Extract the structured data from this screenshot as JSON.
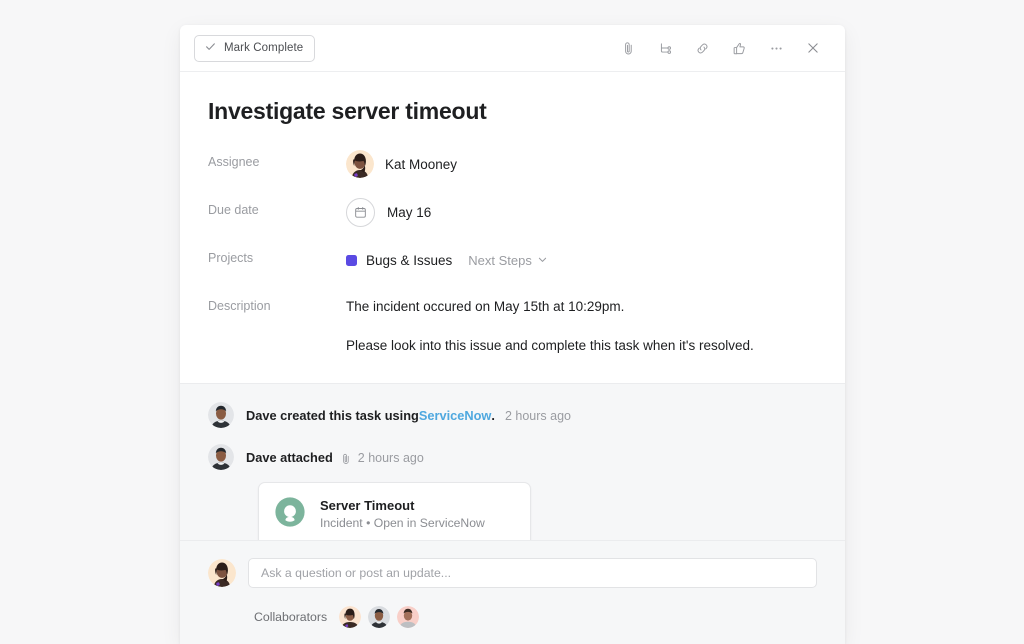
{
  "topbar": {
    "mark_complete_label": "Mark Complete",
    "check_icon": "check-icon",
    "actions": [
      {
        "name": "attachment-icon",
        "label": "Attach file"
      },
      {
        "name": "subtask-icon",
        "label": "Add subtask"
      },
      {
        "name": "link-icon",
        "label": "Copy task link"
      },
      {
        "name": "like-icon",
        "label": "Like task"
      },
      {
        "name": "more-icon",
        "label": "More actions"
      },
      {
        "name": "close-icon",
        "label": "Close"
      }
    ]
  },
  "task": {
    "title": "Investigate server timeout",
    "fields": {
      "assignee_label": "Assignee",
      "assignee_name": "Kat Mooney",
      "due_date_label": "Due date",
      "due_date_value": "May 16",
      "due_date_icon": "calendar-icon",
      "projects_label": "Projects",
      "project_name": "Bugs & Issues",
      "project_color": "#5a4ae3",
      "project_section": "Next Steps",
      "project_section_icon": "chevron-down-icon",
      "description_label": "Description",
      "description_line_1": "The incident occured on May 15th at 10:29pm.",
      "description_line_2": "Please look into this issue and complete this task when it's resolved."
    }
  },
  "activity": [
    {
      "actor": "Dave",
      "text_before": "Dave created this task using ",
      "link_text": "ServiceNow",
      "link_color": "#4fa8df",
      "text_after": ".",
      "time": "2 hours ago"
    },
    {
      "actor": "Dave",
      "text_before": "Dave attached",
      "inline_icon": "attachment-icon",
      "time": "2 hours ago"
    }
  ],
  "attachment": {
    "logo_icon": "servicenow-logo-icon",
    "logo_color": "#7cb49c",
    "title": "Server Timeout",
    "subtitle": "Incident • Open in ServiceNow"
  },
  "composer": {
    "placeholder": "Ask a question or post an update...",
    "value": "",
    "collaborators_label": "Collaborators",
    "collaborators": [
      {
        "name": "collaborator-avatar-1",
        "bg": "#fbe3cf"
      },
      {
        "name": "collaborator-avatar-2",
        "bg": "#d9dce0"
      },
      {
        "name": "collaborator-avatar-3",
        "bg": "#f8cfc8"
      }
    ]
  }
}
